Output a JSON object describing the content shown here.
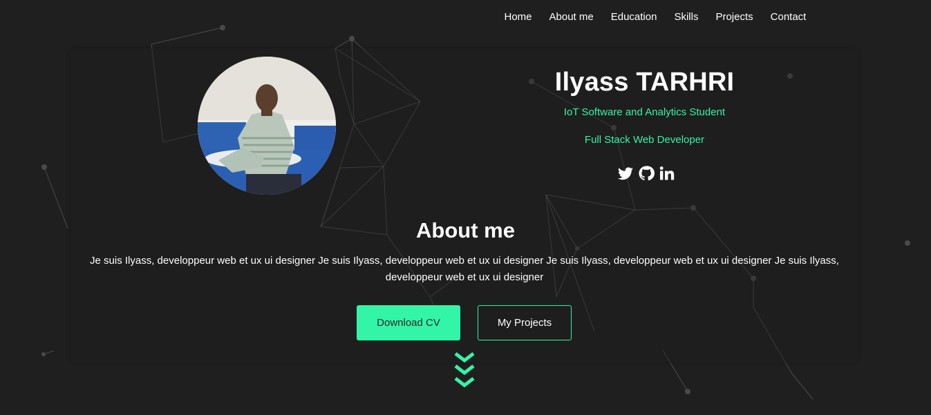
{
  "nav": {
    "items": [
      {
        "label": "Home"
      },
      {
        "label": "About me"
      },
      {
        "label": "Education"
      },
      {
        "label": "Skills"
      },
      {
        "label": "Projects"
      },
      {
        "label": "Contact"
      }
    ]
  },
  "profile": {
    "name": "Ilyass TARHRI",
    "subtitle_1": "IoT Software and Analytics Student",
    "subtitle_2": "Full Stack Web Developer",
    "socials": [
      "twitter-icon",
      "github-icon",
      "linkedin-icon"
    ]
  },
  "about": {
    "title": "About me",
    "text": "Je suis Ilyass, developpeur web et ux ui designer Je suis Ilyass, developpeur web et ux ui designer Je suis Ilyass, developpeur web et ux ui designer Je suis Ilyass, developpeur web et ux ui designer"
  },
  "buttons": {
    "download_cv": "Download CV",
    "my_projects": "My Projects"
  },
  "colors": {
    "accent": "#33f5a7",
    "background": "#1f1f1f",
    "text": "#ffffff"
  }
}
